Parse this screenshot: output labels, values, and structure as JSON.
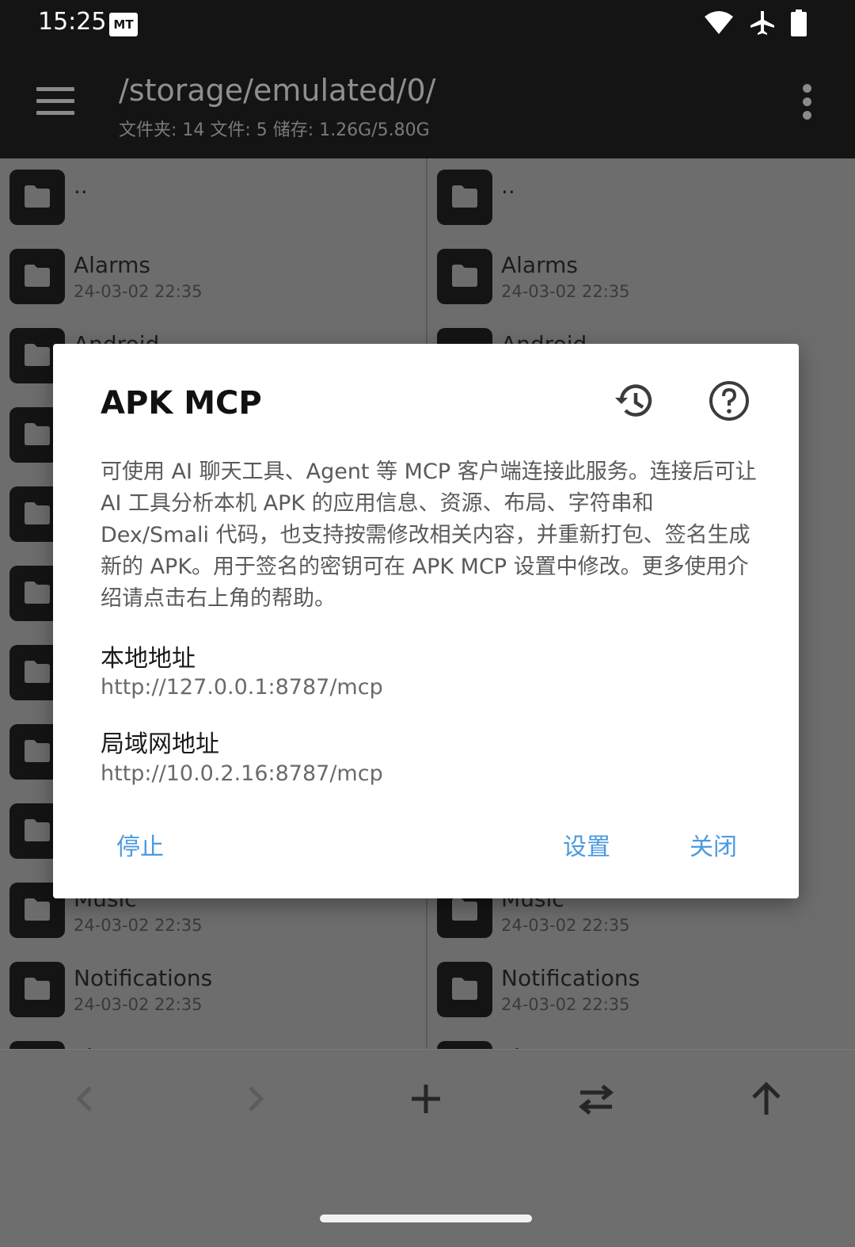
{
  "status_bar": {
    "time": "15:25",
    "app_badge": "MT",
    "icons": [
      "wifi-icon",
      "airplane-icon",
      "battery-icon"
    ]
  },
  "toolbar": {
    "path": "/storage/emulated/0/",
    "summary": "文件夹: 14  文件: 5  储存: 1.26G/5.80G"
  },
  "left_pane": {
    "rows": [
      {
        "name": "..",
        "date": ""
      },
      {
        "name": "Alarms",
        "date": "24-03-02 22:35"
      },
      {
        "name": "Android",
        "date": ""
      },
      {
        "name": "",
        "date": ""
      },
      {
        "name": "",
        "date": ""
      },
      {
        "name": "",
        "date": ""
      },
      {
        "name": "",
        "date": ""
      },
      {
        "name": "",
        "date": ""
      },
      {
        "name": "",
        "date": ""
      },
      {
        "name": "Music",
        "date": "24-03-02 22:35"
      },
      {
        "name": "Notifications",
        "date": "24-03-02 22:35"
      },
      {
        "name": "Pictures",
        "date": ""
      }
    ]
  },
  "right_pane": {
    "rows": [
      {
        "name": "..",
        "date": ""
      },
      {
        "name": "Alarms",
        "date": "24-03-02 22:35"
      },
      {
        "name": "Android",
        "date": ""
      },
      {
        "name": "",
        "date": ""
      },
      {
        "name": "",
        "date": ""
      },
      {
        "name": "",
        "date": ""
      },
      {
        "name": "",
        "date": ""
      },
      {
        "name": "",
        "date": ""
      },
      {
        "name": "",
        "date": ""
      },
      {
        "name": "Music",
        "date": "24-03-02 22:35"
      },
      {
        "name": "Notifications",
        "date": "24-03-02 22:35"
      },
      {
        "name": "Pictures",
        "date": ""
      }
    ]
  },
  "bottom_bar": {
    "buttons": [
      "back-icon",
      "forward-icon",
      "add-icon",
      "swap-icon",
      "up-arrow-icon"
    ]
  },
  "dialog": {
    "title": "APK MCP",
    "description": "可使用 AI 聊天工具、Agent 等 MCP 客户端连接此服务。连接后可让 AI 工具分析本机 APK 的应用信息、资源、布局、字符串和 Dex/Smali 代码，也支持按需修改相关内容，并重新打包、签名生成新的 APK。用于签名的密钥可在 APK MCP 设置中修改。更多使用介绍请点击右上角的帮助。",
    "local_label": "本地地址",
    "local_value": "http://127.0.0.1:8787/mcp",
    "lan_label": "局域网地址",
    "lan_value": "http://10.0.2.16:8787/mcp",
    "stop_label": "停止",
    "settings_label": "设置",
    "close_label": "关闭"
  },
  "colors": {
    "accent": "#4a9ae0",
    "dark_bar": "#141414",
    "scrim": "#6d6d6d"
  }
}
